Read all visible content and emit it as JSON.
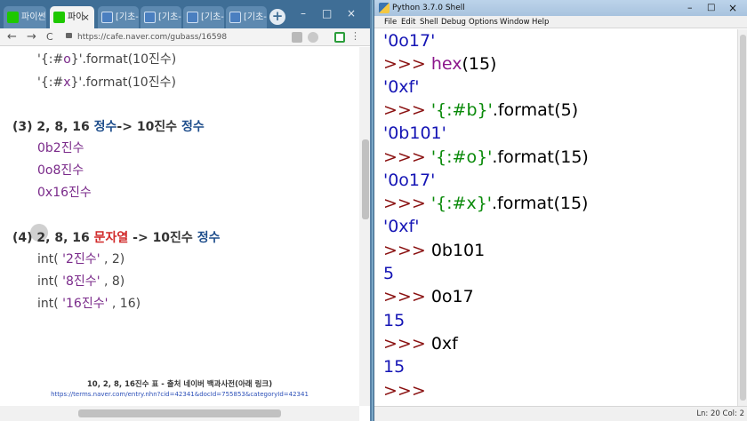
{
  "browser": {
    "tabs": [
      {
        "label": "파이썬",
        "icon": "naver-icon",
        "active": false
      },
      {
        "label": "파이",
        "icon": "naver-icon",
        "active": true
      },
      {
        "label": "[기초-",
        "icon": "blue-doc-icon",
        "active": false
      },
      {
        "label": "[기초-",
        "icon": "blue-doc-icon",
        "active": false
      },
      {
        "label": "[기초-",
        "icon": "blue-doc-icon",
        "active": false
      },
      {
        "label": "[기초-",
        "icon": "blue-doc-icon",
        "active": false
      }
    ],
    "tab_close_glyph": "×",
    "new_tab_glyph": "+",
    "window_controls": [
      "–",
      "□",
      "×"
    ],
    "nav": {
      "back": "←",
      "forward": "→",
      "reload": "C"
    },
    "url": "https://cafe.naver.com/gubass/16598"
  },
  "content": {
    "format_lines": [
      {
        "prefix": "'{:#",
        "letter": "o",
        "suffix": "}'.format(10진수)"
      },
      {
        "prefix": "'{:#",
        "letter": "x",
        "suffix": "}'.format(10진수)"
      }
    ],
    "section3": {
      "label": "(3) 2, 8, 16 ",
      "kw1": "정수",
      "mid": "-> 10진수 ",
      "kw2": "정수",
      "items": [
        "0b2진수",
        "0o8진수",
        "0x16진수"
      ]
    },
    "section4": {
      "label": "(4) 2, 8, 16 ",
      "kw1": "문자열",
      "mid": " -> 10진수 ",
      "kw2": "정수",
      "items": [
        {
          "pre": "int( ",
          "str": "'2진수'",
          "post": " , 2)"
        },
        {
          "pre": "int( ",
          "str": "'8진수'",
          "post": " , 8)"
        },
        {
          "pre": "int( ",
          "str": "'16진수'",
          "post": " , 16)"
        }
      ]
    },
    "caption": "10, 2, 8, 16진수 표 - 출처 네이버 백과사전(아래 링크)",
    "link": "https://terms.naver.com/entry.nhn?cid=42341&docId=755853&categoryId=42341"
  },
  "shell": {
    "title": "Python 3.7.0 Shell",
    "window_controls": [
      "–",
      "□",
      "×"
    ],
    "menu": [
      "File",
      "Edit",
      "Shell",
      "Debug",
      "Options",
      "Window",
      "Help"
    ],
    "prompt": ">>> ",
    "lines": [
      {
        "kind": "out",
        "text": "'0o17'"
      },
      {
        "kind": "cmd",
        "builtin": "hex",
        "rest": "(15)"
      },
      {
        "kind": "out",
        "text": "'0xf'"
      },
      {
        "kind": "cmd",
        "str": "'{:#b}'",
        "rest": ".format(5)"
      },
      {
        "kind": "out",
        "text": "'0b101'"
      },
      {
        "kind": "cmd",
        "str": "'{:#o}'",
        "rest": ".format(15)"
      },
      {
        "kind": "out",
        "text": "'0o17'"
      },
      {
        "kind": "cmd",
        "str": "'{:#x}'",
        "rest": ".format(15)"
      },
      {
        "kind": "out",
        "text": "'0xf'"
      },
      {
        "kind": "cmd",
        "rest": "0b101"
      },
      {
        "kind": "out",
        "text": "5"
      },
      {
        "kind": "cmd",
        "rest": "0o17"
      },
      {
        "kind": "out",
        "text": "15"
      },
      {
        "kind": "cmd",
        "rest": "0xf"
      },
      {
        "kind": "out",
        "text": "15"
      },
      {
        "kind": "cmd",
        "rest": ""
      }
    ],
    "status": "Ln: 20  Col: 2"
  }
}
